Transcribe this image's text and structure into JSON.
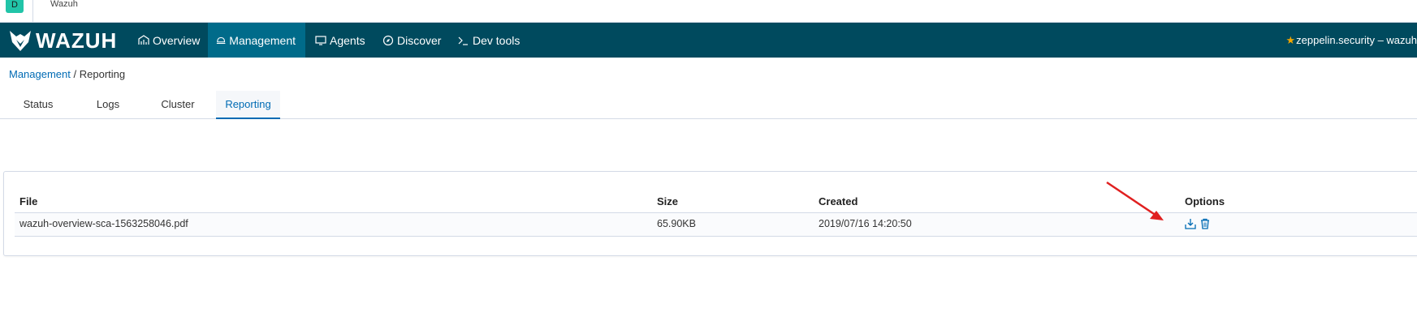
{
  "top_strip": {
    "space_initial": "D",
    "app_name": "Wazuh"
  },
  "nav": {
    "logo_text": "WAZUH",
    "items": [
      {
        "label": "Overview",
        "icon": "overview-icon"
      },
      {
        "label": "Management",
        "icon": "management-icon"
      },
      {
        "label": "Agents",
        "icon": "monitor-icon"
      },
      {
        "label": "Discover",
        "icon": "compass-icon"
      },
      {
        "label": "Dev tools",
        "icon": "console-icon"
      }
    ],
    "active": "Management",
    "user_label": "zeppelin.security – wazuh"
  },
  "breadcrumb": {
    "parent": "Management",
    "separator": " / ",
    "current": "Reporting"
  },
  "tabs": [
    {
      "label": "Status"
    },
    {
      "label": "Logs"
    },
    {
      "label": "Cluster"
    },
    {
      "label": "Reporting"
    }
  ],
  "active_tab": "Reporting",
  "table": {
    "columns": [
      "File",
      "Size",
      "Created",
      "Options"
    ],
    "rows": [
      {
        "file": "wazuh-overview-sca-1563258046.pdf",
        "size": "65.90KB",
        "created": "2019/07/16 14:20:50",
        "options": [
          "download-icon",
          "trash-icon"
        ]
      }
    ]
  },
  "colors": {
    "nav_bg": "#004a5e",
    "nav_active": "#006b8a",
    "link": "#006bb4",
    "star": "#f5a700",
    "annotation_arrow": "#e02020",
    "space_avatar": "#21c4a8"
  }
}
